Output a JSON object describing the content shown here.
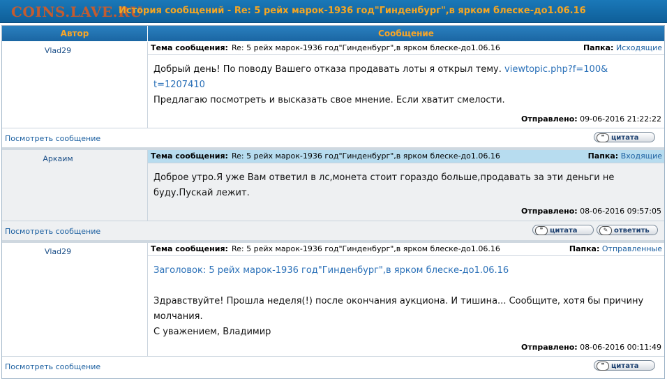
{
  "window": {
    "watermark": "COINS.LAVE.RU",
    "title": "История сообщений - Re: 5 рейх марок-1936 год\"Гинденбург\",в ярком блеске-до1.06.16"
  },
  "table": {
    "col_author": "Автор",
    "col_message": "Сообщение"
  },
  "labels": {
    "subject": "Тема сообщения:",
    "folder": "Папка:",
    "sent": "Отправлено:",
    "view_message": "Посмотреть сообщение",
    "quote_button": "цитата",
    "reply_button": "ответить"
  },
  "messages": [
    {
      "author": "Vlad29",
      "subject": "Re: 5 рейх марок-1936 год\"Гинденбург\",в ярком блеске-до1.06.16",
      "folder": "Исходящие",
      "line1": "Добрый день! По поводу Вашего отказа продавать лоты я открыл тему.",
      "link1": "viewtopic.php?f=100&",
      "link2": "t=1207410",
      "line2": "Предлагаю посмотреть и высказать свое мнение. Если хватит смелости.",
      "sent": "09-06-2016 21:22:22"
    },
    {
      "author": "Аркаим",
      "subject": "Re: 5 рейх марок-1936 год\"Гинденбург\",в ярком блеске-до1.06.16",
      "folder": "Входящие",
      "line1": "Доброе утро.Я уже Вам ответил в лс,монета стоит гораздо больше,продавать за эти деньги не",
      "line2": "буду.Пускай лежит.",
      "sent": "08-06-2016 09:57:05"
    },
    {
      "author": "Vlad29",
      "subject": "Re: 5 рейх марок-1936 год\"Гинденбург\",в ярком блеске-до1.06.16",
      "folder": "Отправленные",
      "heading": "Заголовок: 5 рейх марок-1936 год\"Гинденбург\",в ярком блеске-до1.06.16",
      "line1": "Здравствуйте! Прошла неделя(!) после окончания аукциона. И тишина... Сообщите, хотя бы причину",
      "line2": "молчания.",
      "line3": "С уважением, Владимир",
      "sent": "08-06-2016 00:11:49"
    }
  ],
  "colors": {
    "header_bg": "#1b66a3",
    "header_text": "#f7a528",
    "highlight_row": "#b7dcef",
    "link": "#1b5fa0"
  }
}
